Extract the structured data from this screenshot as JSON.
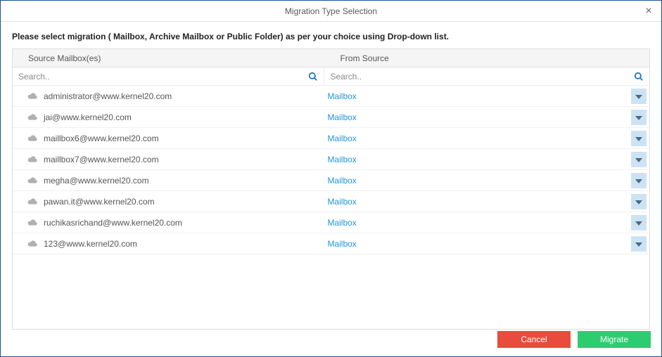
{
  "window": {
    "title": "Migration Type Selection"
  },
  "instruction": "Please select migration ( Mailbox, Archive Mailbox or Public Folder) as per your choice using Drop-down list.",
  "table": {
    "headers": {
      "source_mailbox": "Source Mailbox(es)",
      "from_source": "From Source"
    },
    "search": {
      "left_placeholder": "Search..",
      "right_placeholder": "Search.."
    },
    "rows": [
      {
        "mailbox": "administrator@www.kernel20.com",
        "source": "Mailbox"
      },
      {
        "mailbox": "jai@www.kernel20.com",
        "source": "Mailbox"
      },
      {
        "mailbox": "maillbox6@www.kernel20.com",
        "source": "Mailbox"
      },
      {
        "mailbox": "maillbox7@www.kernel20.com",
        "source": "Mailbox"
      },
      {
        "mailbox": "megha@www.kernel20.com",
        "source": "Mailbox"
      },
      {
        "mailbox": "pawan.it@www.kernel20.com",
        "source": "Mailbox"
      },
      {
        "mailbox": "ruchikasrichand@www.kernel20.com",
        "source": "Mailbox"
      },
      {
        "mailbox": "123@www.kernel20.com",
        "source": "Mailbox"
      }
    ]
  },
  "buttons": {
    "cancel": "Cancel",
    "migrate": "Migrate"
  }
}
